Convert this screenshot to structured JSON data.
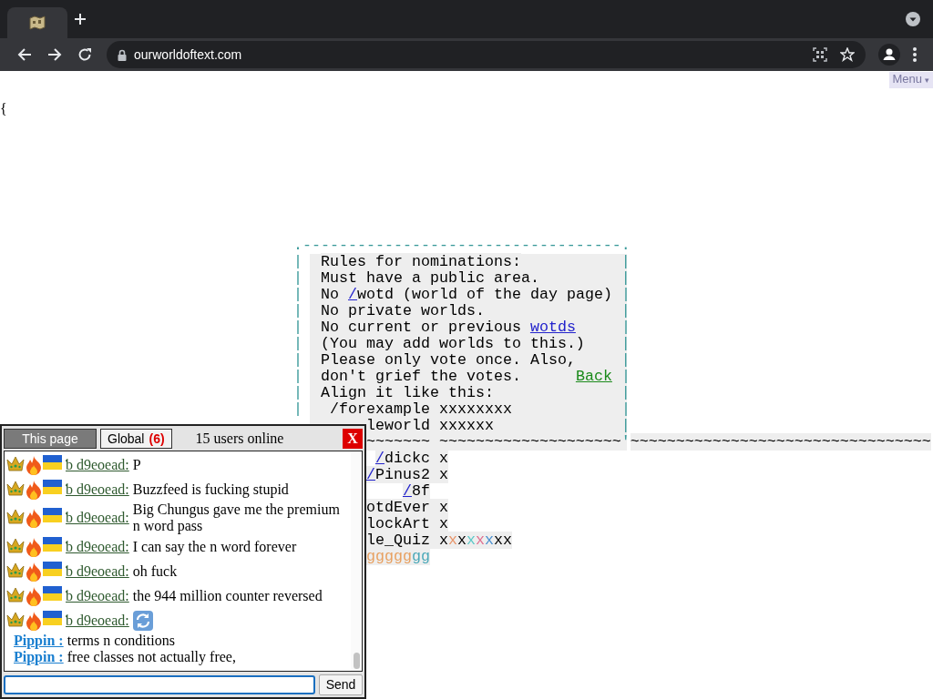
{
  "browser": {
    "url": "ourworldoftext.com"
  },
  "menu": {
    "label": "Menu",
    "caret": "▾"
  },
  "stray_text": "{",
  "canvas": {
    "rows": [
      {
        "cells": [
          {
            "kind": "border",
            "text": " .-----------------------------------."
          }
        ]
      },
      {
        "cells": [
          {
            "kind": "border",
            "text": " |"
          },
          {
            "kind": "text",
            "text": "  Rules for nominations:"
          },
          {
            "kind": "border",
            "text": "           |"
          }
        ]
      },
      {
        "cells": [
          {
            "kind": "border",
            "text": " |"
          },
          {
            "kind": "text",
            "text": "  Must have a public area."
          },
          {
            "kind": "border",
            "text": "         |"
          }
        ]
      },
      {
        "cells": [
          {
            "kind": "border",
            "text": " |"
          },
          {
            "kind": "text",
            "parts": [
              {
                "kind": "plain",
                "text": "  No "
              },
              {
                "kind": "link",
                "text": "/"
              },
              {
                "kind": "plain",
                "text": "wotd (world of the day page)"
              }
            ]
          },
          {
            "kind": "border",
            "text": " |"
          }
        ]
      },
      {
        "cells": [
          {
            "kind": "border",
            "text": " |"
          },
          {
            "kind": "text",
            "text": "  No private worlds."
          },
          {
            "kind": "border",
            "text": "               |"
          }
        ]
      },
      {
        "cells": [
          {
            "kind": "border",
            "text": " |"
          },
          {
            "kind": "text",
            "parts": [
              {
                "kind": "plain",
                "text": "  No current or previous "
              },
              {
                "kind": "link",
                "text": "wotds"
              }
            ]
          },
          {
            "kind": "border",
            "text": "     |"
          }
        ]
      },
      {
        "cells": [
          {
            "kind": "border",
            "text": " |"
          },
          {
            "kind": "text",
            "text": "  (You may add worlds to this.)"
          },
          {
            "kind": "border",
            "text": "    |"
          }
        ]
      },
      {
        "cells": [
          {
            "kind": "border",
            "text": " |"
          },
          {
            "kind": "text",
            "text": "  Please only vote once. Also,"
          },
          {
            "kind": "border",
            "text": "     |"
          }
        ]
      },
      {
        "cells": [
          {
            "kind": "border",
            "text": " |"
          },
          {
            "kind": "text",
            "text": "  don't grief the votes."
          },
          {
            "kind": "back",
            "text": "      Back"
          },
          {
            "kind": "border",
            "text": " |"
          }
        ]
      },
      {
        "cells": [
          {
            "kind": "border",
            "text": " |"
          },
          {
            "kind": "text",
            "text": "  Align it like this:"
          },
          {
            "kind": "border",
            "text": "              |"
          }
        ]
      },
      {
        "cells": [
          {
            "kind": "border",
            "text": " |"
          },
          {
            "kind": "text",
            "text": "   /forexample xxxxxxxx"
          },
          {
            "kind": "border",
            "text": "            |"
          }
        ]
      },
      {
        "cells": [
          {
            "kind": "text",
            "text": "         leworld xxxxxx"
          },
          {
            "kind": "border",
            "text": "              |"
          }
        ]
      },
      {
        "cells": [
          {
            "kind": "text",
            "text": "         ~~~~~~~ ~~~~~~~~~~~~~~~~~~~~"
          },
          {
            "kind": "border",
            "text": "'"
          },
          {
            "kind": "text",
            "text": "~~~~~~~~~~~~~~~~~~~~~~~~~~~~~~~~~"
          }
        ]
      },
      {
        "cells": [
          {
            "kind": "text",
            "parts": [
              {
                "kind": "link",
                "text": "          /"
              },
              {
                "kind": "plain",
                "text": "dickc x"
              }
            ]
          }
        ]
      },
      {
        "cells": [
          {
            "kind": "text",
            "parts": [
              {
                "kind": "link",
                "text": "         /"
              },
              {
                "kind": "plain",
                "text": "Pinus2 x"
              }
            ]
          }
        ]
      },
      {
        "cells": [
          {
            "kind": "text",
            "parts": [
              {
                "kind": "link",
                "text": "             /"
              },
              {
                "kind": "plain",
                "text": "8f"
              }
            ]
          }
        ]
      },
      {
        "cells": [
          {
            "kind": "text",
            "text": "         otdEver x"
          }
        ]
      },
      {
        "cells": [
          {
            "kind": "text",
            "text": "         lockArt x"
          }
        ]
      },
      {
        "cells": [
          {
            "kind": "text",
            "parts": [
              {
                "kind": "plain",
                "text": "         le_Quiz x"
              },
              {
                "kind": "plain",
                "text": "x",
                "color": "#e8956a"
              },
              {
                "kind": "plain",
                "text": "x"
              },
              {
                "kind": "plain",
                "text": "x",
                "color": "#5cc8c8"
              },
              {
                "kind": "plain",
                "text": "x",
                "color": "#e07090"
              },
              {
                "kind": "plain",
                "text": "x",
                "color": "#4a90d0"
              },
              {
                "kind": "plain",
                "text": "xx"
              }
            ]
          }
        ]
      },
      {
        "cells": [
          {
            "kind": "text",
            "parts": [
              {
                "kind": "plain",
                "text": "         ggggg",
                "color": "#e8a060"
              },
              {
                "kind": "plain",
                "text": "gg",
                "color": "#4aa8b8"
              }
            ]
          }
        ]
      }
    ]
  },
  "chat": {
    "tabs": [
      {
        "label": "This page",
        "selected": true
      },
      {
        "label": "Global",
        "count": "(6)",
        "selected": false
      }
    ],
    "online": "15 users online",
    "close": "X",
    "messages": [
      {
        "kind": "badged",
        "nick": "ƅ d9eoead:",
        "color": "#2f5a2f",
        "icon": false,
        "text": "P"
      },
      {
        "kind": "badged",
        "nick": "ƅ d9eoead:",
        "color": "#2f5a2f",
        "icon": false,
        "text": "Buzzfeed is fucking stupid"
      },
      {
        "kind": "badged",
        "nick": "ƅ d9eoead:",
        "color": "#2f5a2f",
        "icon": false,
        "text": "Big Chungus gave me the premium n word pass"
      },
      {
        "kind": "badged",
        "nick": "ƅ d9eoead:",
        "color": "#2f5a2f",
        "icon": false,
        "text": "I can say the n word forever"
      },
      {
        "kind": "badged",
        "nick": "ƅ d9eoead:",
        "color": "#2f5a2f",
        "icon": false,
        "text": "oh fuck"
      },
      {
        "kind": "badged",
        "nick": "ƅ d9eoead:",
        "color": "#2f5a2f",
        "icon": false,
        "text": "the 944 million counter reversed"
      },
      {
        "kind": "badged",
        "nick": "ƅ d9eoead:",
        "color": "#2f5a2f",
        "icon": true
      },
      {
        "kind": "plain",
        "nick": "Pippin :",
        "color": "#1a7fd0",
        "icon": false,
        "text": "terms n conditions"
      },
      {
        "kind": "plain",
        "nick": "Pippin :",
        "color": "#1a7fd0",
        "icon": false,
        "text": "free classes not actually free,"
      }
    ],
    "send": "Send"
  }
}
